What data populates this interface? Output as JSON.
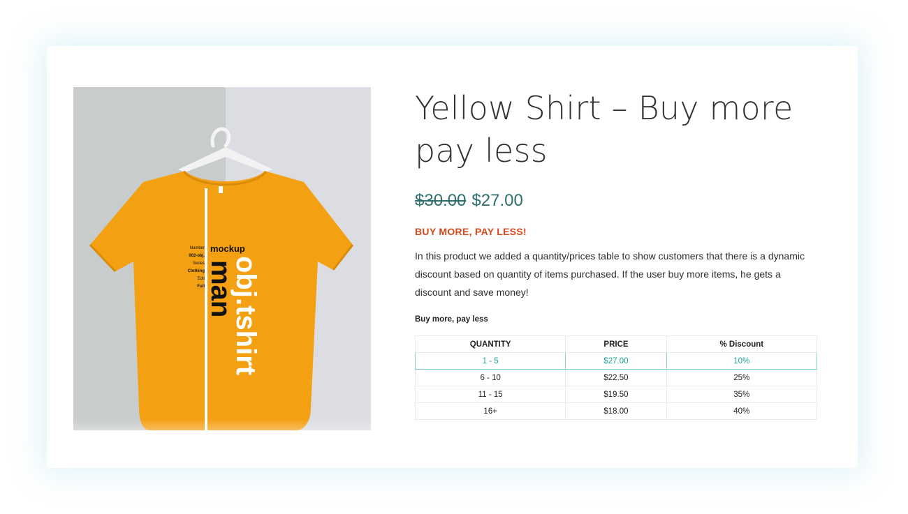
{
  "product": {
    "title": "Yellow Shirt – Buy more pay less",
    "old_price": "$30.00",
    "new_price": "$27.00",
    "promo_heading": "BUY MORE, PAY LESS!",
    "description": "In this product we added a quantity/prices table to show customers that there is a dynamic discount based on quantity of items purchased. If the user buy more items, he gets a discount and save money!",
    "image": {
      "shirt_text_main": "obj.tshirt",
      "shirt_text_mockup": "mockup",
      "shirt_text_man": "man",
      "spec_labels": [
        "Number",
        "002-obj.",
        "Series",
        "Clothing",
        "Edit",
        "Full"
      ],
      "shirt_color": "#f4a013"
    }
  },
  "discount_table": {
    "caption": "Buy more, pay less",
    "headers": [
      "QUANTITY",
      "PRICE",
      "% Discount"
    ],
    "rows": [
      {
        "quantity": "1 - 5",
        "price": "$27.00",
        "discount": "10%",
        "active": true
      },
      {
        "quantity": "6 - 10",
        "price": "$22.50",
        "discount": "25%",
        "active": false
      },
      {
        "quantity": "11 - 15",
        "price": "$19.50",
        "discount": "35%",
        "active": false
      },
      {
        "quantity": "16+",
        "price": "$18.00",
        "discount": "40%",
        "active": false
      }
    ]
  },
  "colors": {
    "price": "#2b6e6e",
    "promo": "#d5481a",
    "active_row": "#1aa39a"
  }
}
